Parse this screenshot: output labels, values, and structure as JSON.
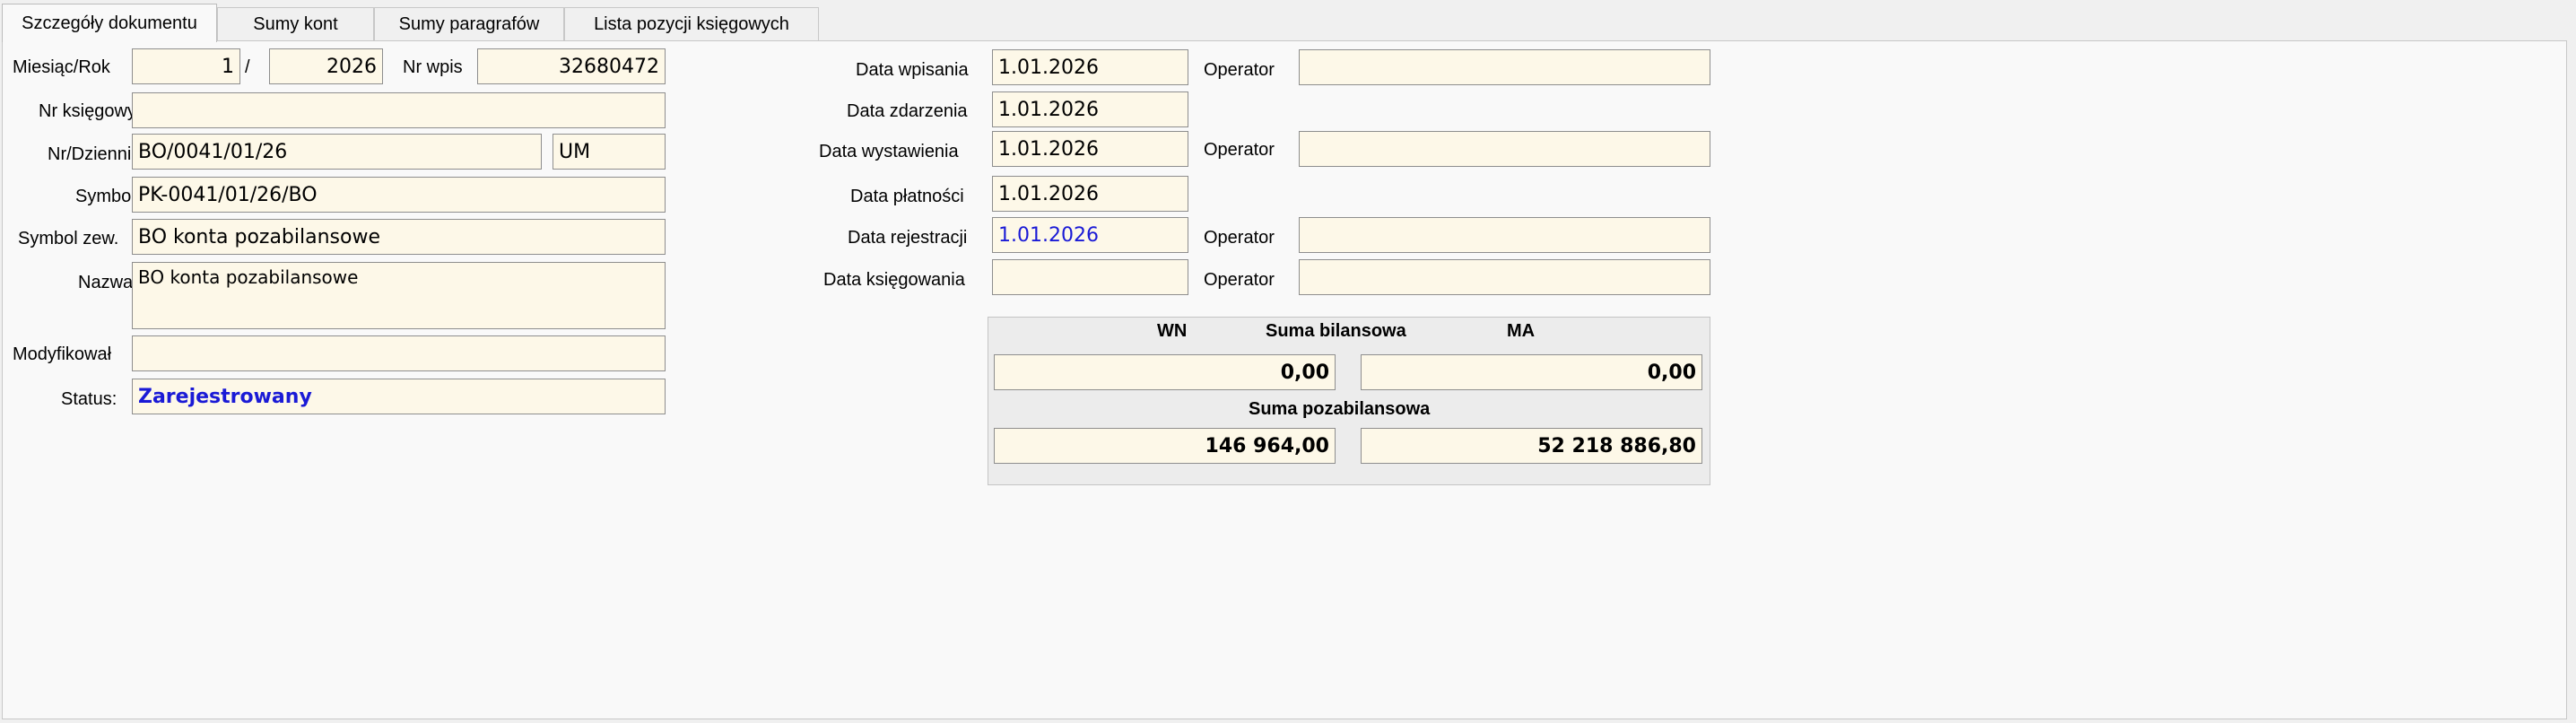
{
  "tabs": [
    {
      "label": "Szczegóły dokumentu",
      "active": true
    },
    {
      "label": "Sumy kont",
      "active": false
    },
    {
      "label": "Sumy paragrafów",
      "active": false
    },
    {
      "label": "Lista pozycji księgowych",
      "active": false
    }
  ],
  "left": {
    "miesiac_rok_label": "Miesiąc/Rok",
    "miesiac": "1",
    "separator": "/",
    "rok": "2026",
    "nr_wpis_label": "Nr wpis",
    "nr_wpis": "32680472",
    "nr_ksiegowy_label": "Nr księgowy",
    "nr_ksiegowy": "",
    "nr_dziennik_label": "Nr/Dziennik",
    "nr_dziennik": "BO/0041/01/26",
    "dziennik": "UM",
    "symbol_label": "Symbol",
    "symbol": "PK-0041/01/26/BO",
    "symbol_zew_label": "Symbol zew.",
    "symbol_zew": "BO konta pozabilansowe",
    "nazwa_label": "Nazwa",
    "nazwa": "BO konta pozabilansowe",
    "modyfikowal_label": "Modyfikował",
    "modyfikowal": "",
    "status_label": "Status:",
    "status": "Zarejestrowany"
  },
  "dates": {
    "operator_label": "Operator",
    "data_wpisania_label": "Data wpisania",
    "data_wpisania": "1.01.2026",
    "operator_wpisania": "",
    "data_zdarzenia_label": "Data zdarzenia",
    "data_zdarzenia": "1.01.2026",
    "data_wystawienia_label": "Data wystawienia",
    "data_wystawienia": "1.01.2026",
    "operator_wystawienia": "",
    "data_platnosci_label": "Data płatności",
    "data_platnosci": "1.01.2026",
    "data_rejestracji_label": "Data rejestracji",
    "data_rejestracji": "1.01.2026",
    "operator_rejestracji": "",
    "data_ksiegowania_label": "Data księgowania",
    "data_ksiegowania": "",
    "operator_ksiegowania": ""
  },
  "sums": {
    "wn_label": "WN",
    "bilansowa_label": "Suma bilansowa",
    "ma_label": "MA",
    "bilansowa_wn": "0,00",
    "bilansowa_ma": "0,00",
    "pozabilansowa_label": "Suma pozabilansowa",
    "pozabilansowa_wn": "146 964,00",
    "pozabilansowa_ma": "52 218 886,80"
  },
  "colors": {
    "field_bg": "#fdf8e8",
    "status_text": "#1a1ad6",
    "rejestracji_text": "#1a1ad6"
  }
}
